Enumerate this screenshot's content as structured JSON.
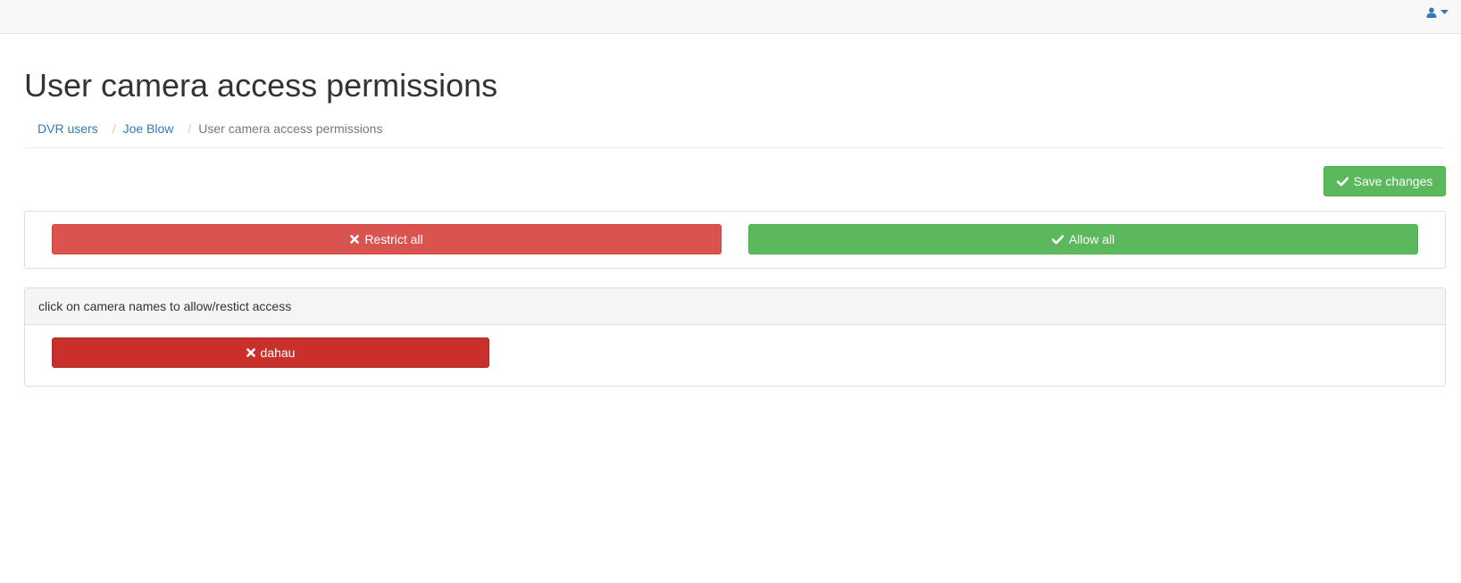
{
  "navbar": {
    "user_icon": "user-icon",
    "caret_icon": "caret-down-icon"
  },
  "page": {
    "title": "User camera access permissions"
  },
  "breadcrumb": {
    "items": [
      {
        "label": "DVR users"
      },
      {
        "label": "Joe Blow"
      }
    ],
    "separator": "/",
    "active": "User camera access permissions"
  },
  "toolbar": {
    "save_label": "Save changes",
    "save_icon": "check-icon"
  },
  "bulk_actions": {
    "restrict_label": "Restrict all",
    "restrict_icon": "x-icon",
    "allow_label": "Allow all",
    "allow_icon": "check-icon"
  },
  "cameras": {
    "hint": "click on camera names to allow/restict access",
    "items": [
      {
        "name": "dahau",
        "status": "restricted",
        "icon": "x-icon"
      }
    ]
  },
  "colors": {
    "success": "#5cb85c",
    "danger": "#d9534f",
    "danger_active": "#c9302c",
    "link": "#337ab7"
  }
}
